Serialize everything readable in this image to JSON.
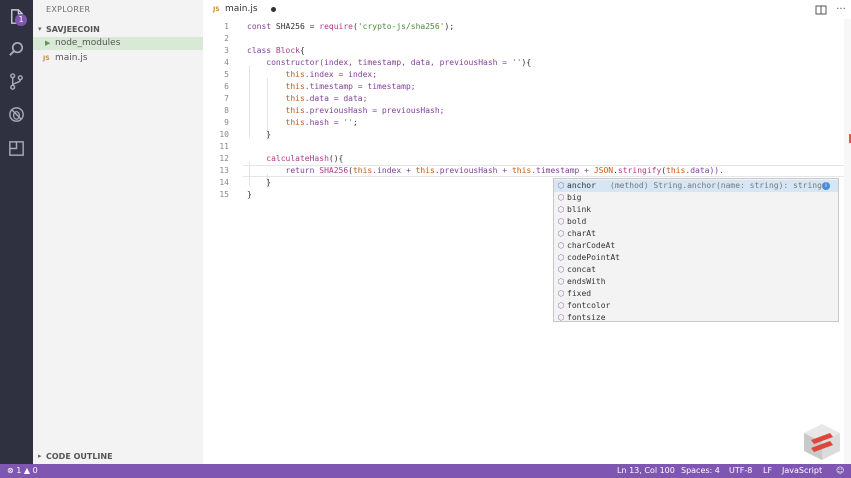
{
  "sidebar": {
    "header": "EXPLORER",
    "project": "SAVJEECOIN",
    "items": [
      {
        "label": "node_modules",
        "type": "folder"
      },
      {
        "label": "main.js",
        "type": "js"
      }
    ],
    "outline": "CODE OUTLINE"
  },
  "activity": {
    "badge": "1",
    "icons": [
      "files-icon",
      "search-icon",
      "source-control-icon",
      "debug-icon",
      "extensions-icon"
    ]
  },
  "tab": {
    "file_label": "JS",
    "title": "main.js",
    "dirty": true
  },
  "editor": {
    "line_numbers": [
      "1",
      "2",
      "3",
      "4",
      "5",
      "6",
      "7",
      "8",
      "9",
      "10",
      "11",
      "12",
      "13",
      "14",
      "15"
    ],
    "current_line": 13,
    "lines": [
      [
        {
          "t": "const ",
          "c": "k"
        },
        {
          "t": "SHA256 = ",
          "c": "p"
        },
        {
          "t": "require",
          "c": "fn"
        },
        {
          "t": "(",
          "c": "p"
        },
        {
          "t": "'crypto-js/sha256'",
          "c": "s"
        },
        {
          "t": ");",
          "c": "p"
        }
      ],
      [],
      [
        {
          "t": "class ",
          "c": "k"
        },
        {
          "t": "Block",
          "c": "fn"
        },
        {
          "t": "{",
          "c": "p"
        }
      ],
      [
        {
          "t": "    constructor",
          "c": "k"
        },
        {
          "t": "(index, timestamp, data, previousHash = ",
          "c": "k"
        },
        {
          "t": "''",
          "c": "s"
        },
        {
          "t": "){",
          "c": "p"
        }
      ],
      [
        {
          "t": "        this",
          "c": "th"
        },
        {
          "t": ".index = index;",
          "c": "k"
        }
      ],
      [
        {
          "t": "        this",
          "c": "th"
        },
        {
          "t": ".timestamp = timestamp;",
          "c": "k"
        }
      ],
      [
        {
          "t": "        this",
          "c": "th"
        },
        {
          "t": ".data = data;",
          "c": "k"
        }
      ],
      [
        {
          "t": "        this",
          "c": "th"
        },
        {
          "t": ".previousHash = previousHash;",
          "c": "k"
        }
      ],
      [
        {
          "t": "        this",
          "c": "th"
        },
        {
          "t": ".hash = ",
          "c": "k"
        },
        {
          "t": "''",
          "c": "s"
        },
        {
          "t": ";",
          "c": "p"
        }
      ],
      [
        {
          "t": "    }",
          "c": "p"
        }
      ],
      [],
      [
        {
          "t": "    calculateHash",
          "c": "fn"
        },
        {
          "t": "(){",
          "c": "p"
        }
      ],
      [
        {
          "t": "        return ",
          "c": "k"
        },
        {
          "t": "SHA256",
          "c": "fn"
        },
        {
          "t": "(",
          "c": "p"
        },
        {
          "t": "this",
          "c": "th"
        },
        {
          "t": ".index + ",
          "c": "k"
        },
        {
          "t": "this",
          "c": "th"
        },
        {
          "t": ".previousHash + ",
          "c": "k"
        },
        {
          "t": "this",
          "c": "th"
        },
        {
          "t": ".timestamp + ",
          "c": "k"
        },
        {
          "t": "JSON",
          "c": "th"
        },
        {
          "t": ".",
          "c": "p"
        },
        {
          "t": "stringify",
          "c": "fn"
        },
        {
          "t": "(",
          "c": "p"
        },
        {
          "t": "this",
          "c": "th"
        },
        {
          "t": ".data)).",
          "c": "k"
        }
      ],
      [
        {
          "t": "    }",
          "c": "p"
        }
      ],
      [
        {
          "t": "}",
          "c": "p"
        }
      ]
    ]
  },
  "suggestions": {
    "items": [
      "anchor",
      "big",
      "blink",
      "bold",
      "charAt",
      "charCodeAt",
      "codePointAt",
      "concat",
      "endsWith",
      "fixed",
      "fontcolor",
      "fontsize"
    ],
    "selected_detail": "(method) String.anchor(name: string): string",
    "info": "i"
  },
  "status": {
    "errors": "1",
    "warnings": "0",
    "position": "Ln 13, Col 100",
    "spaces": "Spaces: 4",
    "encoding": "UTF-8",
    "eol": "LF",
    "language": "JavaScript"
  },
  "colors": {
    "status_bg": "#7f57b3",
    "activity_bg": "#2f3140",
    "keyword": "#7f3f98",
    "string": "#4d8a3a"
  }
}
